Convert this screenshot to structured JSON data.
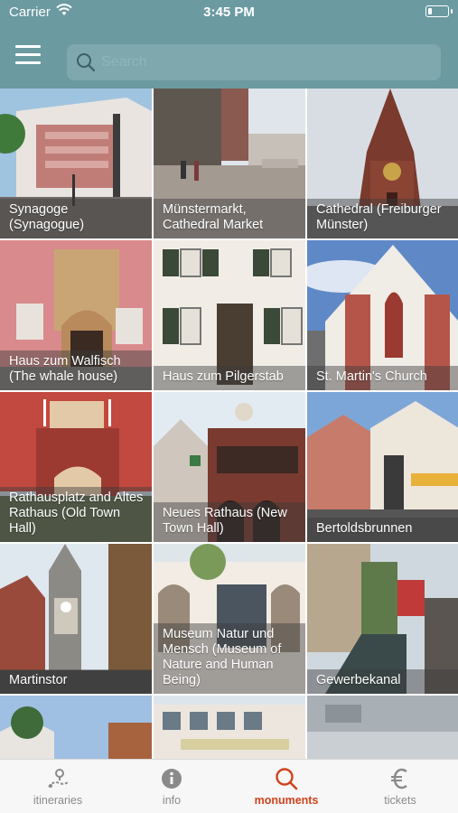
{
  "status": {
    "carrier": "Carrier",
    "time": "3:45 PM",
    "battery_level": 0.2
  },
  "header": {
    "search_placeholder": "Search",
    "search_value": ""
  },
  "tiles": [
    {
      "label": "Synagoge (Synagogue)"
    },
    {
      "label": "Münstermarkt, Cathedral Market"
    },
    {
      "label": "Cathedral (Freiburger Münster)"
    },
    {
      "label": "Haus zum Walfisch (The whale house)"
    },
    {
      "label": "Haus zum Pilgerstab"
    },
    {
      "label": "St. Martin's Church"
    },
    {
      "label": "Rathausplatz and Altes Rathaus (Old Town Hall)"
    },
    {
      "label": "Neues Rathaus (New Town Hall)"
    },
    {
      "label": "Bertoldsbrunnen"
    },
    {
      "label": "Martinstor"
    },
    {
      "label": "Museum Natur und Mensch (Museum of Nature and Human Being)"
    },
    {
      "label": "Gewerbekanal"
    },
    {
      "label": ""
    },
    {
      "label": ""
    },
    {
      "label": ""
    }
  ],
  "tabbar": {
    "active": "monuments",
    "tabs": [
      {
        "id": "itineraries",
        "label": "itineraries",
        "icon": "itineraries-icon"
      },
      {
        "id": "info",
        "label": "info",
        "icon": "info-icon"
      },
      {
        "id": "monuments",
        "label": "monuments",
        "icon": "search-icon"
      },
      {
        "id": "tickets",
        "label": "tickets",
        "icon": "euro-icon"
      }
    ]
  },
  "colors": {
    "header": "#6b9aa1",
    "accent": "#d0421c",
    "tab_inactive": "#8a8a8a"
  }
}
